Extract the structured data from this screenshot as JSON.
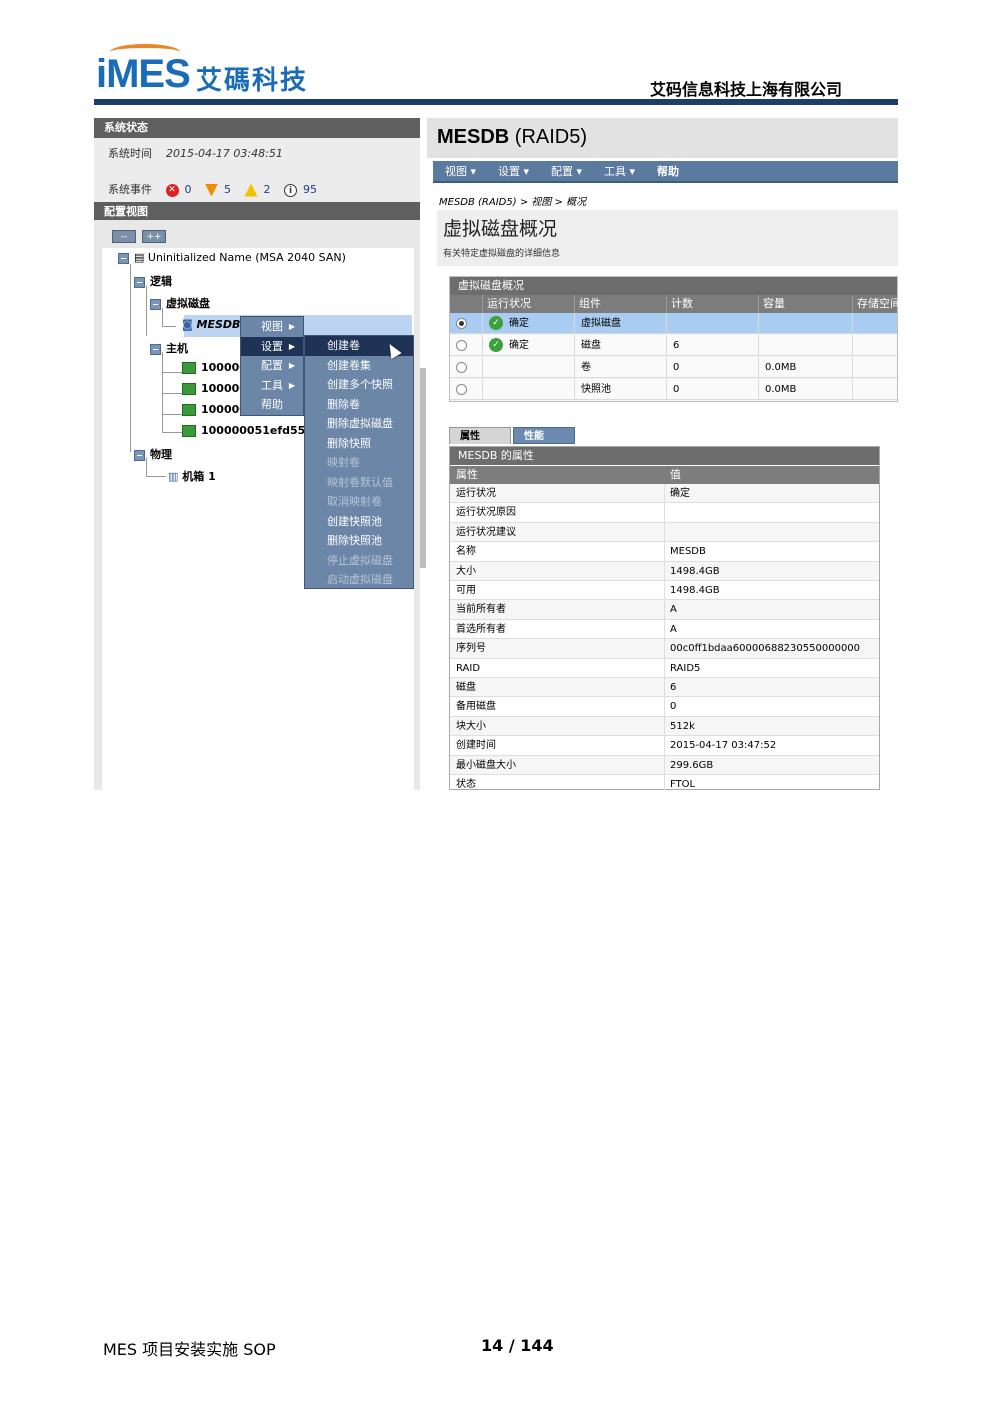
{
  "header": {
    "logo_word": "iMES",
    "logo_cn": "艾碼科技",
    "company": "艾码信息科技上海有限公司"
  },
  "left_pane": {
    "status_title": "系统状态",
    "system_time_label": "系统时间",
    "system_time_value": "2015-04-17 03:48:51",
    "events_label": "系统事件",
    "events": [
      {
        "icon": "error-icon",
        "count": "0"
      },
      {
        "icon": "warning-icon",
        "count": "5"
      },
      {
        "icon": "caution-icon",
        "count": "2"
      },
      {
        "icon": "info-icon",
        "count": "95"
      }
    ],
    "config_title": "配置视图",
    "collapse_label": "--",
    "expand_label": "++",
    "tree": {
      "root": "Uninitialized Name (MSA 2040 SAN)",
      "logical": "逻辑",
      "vdisks": "虚拟磁盘",
      "vdisk_item": "MESDB",
      "hosts": "主机",
      "host_items": [
        "100000",
        "100000",
        "100000",
        "100000051efd5561"
      ],
      "physical": "物理",
      "enclosure": "机箱 1"
    }
  },
  "context_menu": {
    "level1": [
      "视图",
      "设置",
      "配置",
      "工具",
      "帮助"
    ],
    "level2": [
      {
        "label": "创建卷",
        "state": "highlight"
      },
      {
        "label": "创建卷集",
        "state": "enabled"
      },
      {
        "label": "创建多个快照",
        "state": "enabled"
      },
      {
        "label": "删除卷",
        "state": "enabled"
      },
      {
        "label": "删除虚拟磁盘",
        "state": "enabled"
      },
      {
        "label": "删除快照",
        "state": "enabled"
      },
      {
        "label": "映射卷",
        "state": "disabled"
      },
      {
        "label": "映射卷默认值",
        "state": "disabled"
      },
      {
        "label": "取消映射卷",
        "state": "disabled"
      },
      {
        "label": "创建快照池",
        "state": "enabled"
      },
      {
        "label": "删除快照池",
        "state": "enabled"
      },
      {
        "label": "停止虚拟磁盘",
        "state": "disabled"
      },
      {
        "label": "启动虚拟磁盘",
        "state": "disabled"
      }
    ]
  },
  "right_pane": {
    "title_bold": "MESDB",
    "title_rest": " (RAID5)",
    "menubar": [
      "视图 ▾",
      "设置 ▾",
      "配置 ▾",
      "工具 ▾",
      "帮助"
    ],
    "breadcrumb": "MESDB (RAID5) > 视图 > 概况",
    "heading": "虚拟磁盘概况",
    "subheading": "有关特定虚拟磁盘的详细信息",
    "overview": {
      "title": "虚拟磁盘概况",
      "columns": [
        "运行状况",
        "组件",
        "计数",
        "容量",
        "存储空间"
      ],
      "rows": [
        {
          "selected": true,
          "health": "确定",
          "component": "虚拟磁盘",
          "count": "",
          "capacity": ""
        },
        {
          "selected": false,
          "health": "确定",
          "component": "磁盘",
          "count": "6",
          "capacity": ""
        },
        {
          "selected": false,
          "health": "",
          "component": "卷",
          "count": "0",
          "capacity": "0.0MB"
        },
        {
          "selected": false,
          "health": "",
          "component": "快照池",
          "count": "0",
          "capacity": "0.0MB"
        }
      ]
    },
    "tabs": [
      "属性",
      "性能"
    ],
    "properties": {
      "title": "MESDB 的属性",
      "col_key": "属性",
      "col_val": "值",
      "rows": [
        {
          "k": "运行状况",
          "v": "确定"
        },
        {
          "k": "运行状况原因",
          "v": ""
        },
        {
          "k": "运行状况建议",
          "v": ""
        },
        {
          "k": "名称",
          "v": "MESDB"
        },
        {
          "k": "大小",
          "v": "1498.4GB"
        },
        {
          "k": "可用",
          "v": "1498.4GB"
        },
        {
          "k": "当前所有者",
          "v": "A"
        },
        {
          "k": "首选所有者",
          "v": "A"
        },
        {
          "k": "序列号",
          "v": "00c0ff1bdaa60000688230550000000"
        },
        {
          "k": "RAID",
          "v": "RAID5"
        },
        {
          "k": "磁盘",
          "v": "6"
        },
        {
          "k": "备用磁盘",
          "v": "0"
        },
        {
          "k": "块大小",
          "v": "512k"
        },
        {
          "k": "创建时间",
          "v": "2015-04-17 03:47:52"
        },
        {
          "k": "最小磁盘大小",
          "v": "299.6GB"
        },
        {
          "k": "状态",
          "v": "FTOL"
        }
      ]
    }
  },
  "footer": {
    "doc_title": "MES 项目安装实施 SOP",
    "page": "14 / 144"
  }
}
